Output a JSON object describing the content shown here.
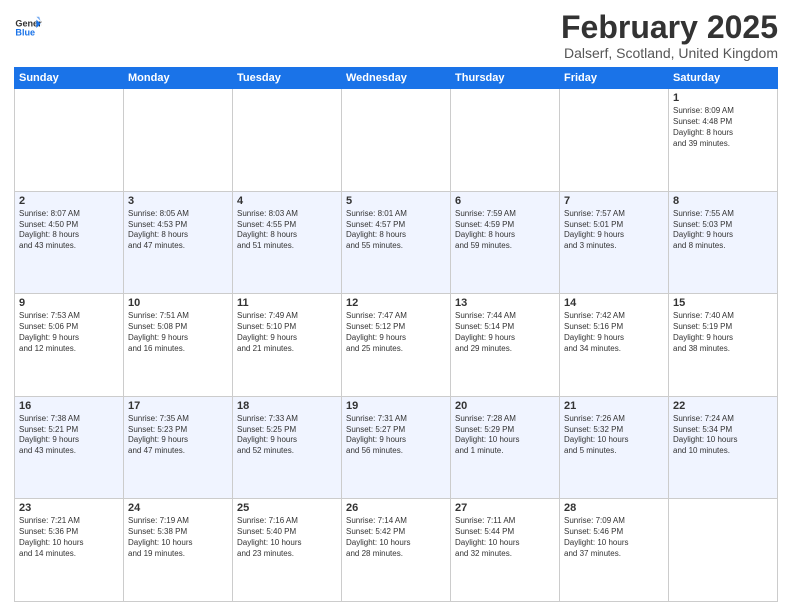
{
  "logo": {
    "line1": "General",
    "line2": "Blue"
  },
  "title": "February 2025",
  "location": "Dalserf, Scotland, United Kingdom",
  "days_of_week": [
    "Sunday",
    "Monday",
    "Tuesday",
    "Wednesday",
    "Thursday",
    "Friday",
    "Saturday"
  ],
  "weeks": [
    [
      {
        "day": "",
        "detail": ""
      },
      {
        "day": "",
        "detail": ""
      },
      {
        "day": "",
        "detail": ""
      },
      {
        "day": "",
        "detail": ""
      },
      {
        "day": "",
        "detail": ""
      },
      {
        "day": "",
        "detail": ""
      },
      {
        "day": "1",
        "detail": "Sunrise: 8:09 AM\nSunset: 4:48 PM\nDaylight: 8 hours\nand 39 minutes."
      }
    ],
    [
      {
        "day": "2",
        "detail": "Sunrise: 8:07 AM\nSunset: 4:50 PM\nDaylight: 8 hours\nand 43 minutes."
      },
      {
        "day": "3",
        "detail": "Sunrise: 8:05 AM\nSunset: 4:53 PM\nDaylight: 8 hours\nand 47 minutes."
      },
      {
        "day": "4",
        "detail": "Sunrise: 8:03 AM\nSunset: 4:55 PM\nDaylight: 8 hours\nand 51 minutes."
      },
      {
        "day": "5",
        "detail": "Sunrise: 8:01 AM\nSunset: 4:57 PM\nDaylight: 8 hours\nand 55 minutes."
      },
      {
        "day": "6",
        "detail": "Sunrise: 7:59 AM\nSunset: 4:59 PM\nDaylight: 8 hours\nand 59 minutes."
      },
      {
        "day": "7",
        "detail": "Sunrise: 7:57 AM\nSunset: 5:01 PM\nDaylight: 9 hours\nand 3 minutes."
      },
      {
        "day": "8",
        "detail": "Sunrise: 7:55 AM\nSunset: 5:03 PM\nDaylight: 9 hours\nand 8 minutes."
      }
    ],
    [
      {
        "day": "9",
        "detail": "Sunrise: 7:53 AM\nSunset: 5:06 PM\nDaylight: 9 hours\nand 12 minutes."
      },
      {
        "day": "10",
        "detail": "Sunrise: 7:51 AM\nSunset: 5:08 PM\nDaylight: 9 hours\nand 16 minutes."
      },
      {
        "day": "11",
        "detail": "Sunrise: 7:49 AM\nSunset: 5:10 PM\nDaylight: 9 hours\nand 21 minutes."
      },
      {
        "day": "12",
        "detail": "Sunrise: 7:47 AM\nSunset: 5:12 PM\nDaylight: 9 hours\nand 25 minutes."
      },
      {
        "day": "13",
        "detail": "Sunrise: 7:44 AM\nSunset: 5:14 PM\nDaylight: 9 hours\nand 29 minutes."
      },
      {
        "day": "14",
        "detail": "Sunrise: 7:42 AM\nSunset: 5:16 PM\nDaylight: 9 hours\nand 34 minutes."
      },
      {
        "day": "15",
        "detail": "Sunrise: 7:40 AM\nSunset: 5:19 PM\nDaylight: 9 hours\nand 38 minutes."
      }
    ],
    [
      {
        "day": "16",
        "detail": "Sunrise: 7:38 AM\nSunset: 5:21 PM\nDaylight: 9 hours\nand 43 minutes."
      },
      {
        "day": "17",
        "detail": "Sunrise: 7:35 AM\nSunset: 5:23 PM\nDaylight: 9 hours\nand 47 minutes."
      },
      {
        "day": "18",
        "detail": "Sunrise: 7:33 AM\nSunset: 5:25 PM\nDaylight: 9 hours\nand 52 minutes."
      },
      {
        "day": "19",
        "detail": "Sunrise: 7:31 AM\nSunset: 5:27 PM\nDaylight: 9 hours\nand 56 minutes."
      },
      {
        "day": "20",
        "detail": "Sunrise: 7:28 AM\nSunset: 5:29 PM\nDaylight: 10 hours\nand 1 minute."
      },
      {
        "day": "21",
        "detail": "Sunrise: 7:26 AM\nSunset: 5:32 PM\nDaylight: 10 hours\nand 5 minutes."
      },
      {
        "day": "22",
        "detail": "Sunrise: 7:24 AM\nSunset: 5:34 PM\nDaylight: 10 hours\nand 10 minutes."
      }
    ],
    [
      {
        "day": "23",
        "detail": "Sunrise: 7:21 AM\nSunset: 5:36 PM\nDaylight: 10 hours\nand 14 minutes."
      },
      {
        "day": "24",
        "detail": "Sunrise: 7:19 AM\nSunset: 5:38 PM\nDaylight: 10 hours\nand 19 minutes."
      },
      {
        "day": "25",
        "detail": "Sunrise: 7:16 AM\nSunset: 5:40 PM\nDaylight: 10 hours\nand 23 minutes."
      },
      {
        "day": "26",
        "detail": "Sunrise: 7:14 AM\nSunset: 5:42 PM\nDaylight: 10 hours\nand 28 minutes."
      },
      {
        "day": "27",
        "detail": "Sunrise: 7:11 AM\nSunset: 5:44 PM\nDaylight: 10 hours\nand 32 minutes."
      },
      {
        "day": "28",
        "detail": "Sunrise: 7:09 AM\nSunset: 5:46 PM\nDaylight: 10 hours\nand 37 minutes."
      },
      {
        "day": "",
        "detail": ""
      }
    ]
  ]
}
